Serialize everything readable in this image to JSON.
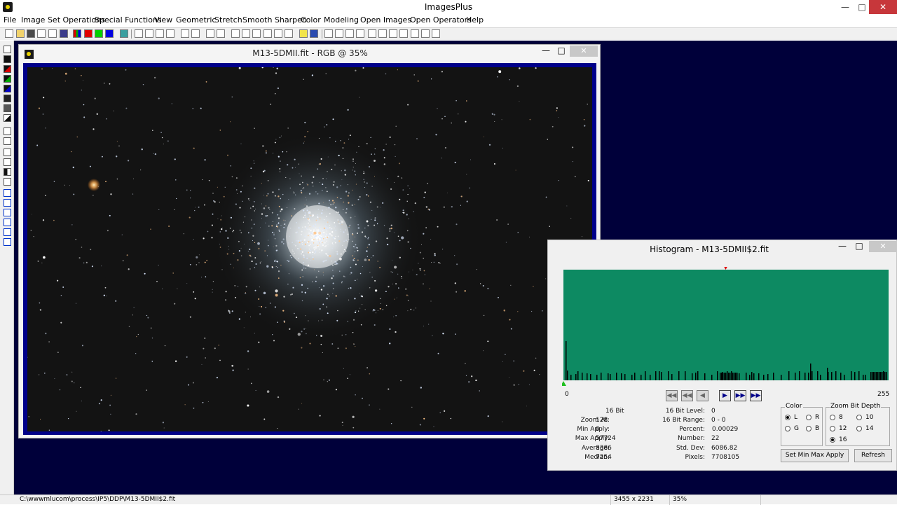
{
  "app": {
    "title": "ImagesPlus",
    "window_controls": {
      "minimize": "—",
      "maximize": "□",
      "close": "✕"
    }
  },
  "menu": [
    "File",
    "Image Set Operations",
    "Special Functions",
    "View",
    "Geometric",
    "Stretch",
    "Smooth Sharpen",
    "Color",
    "Modeling",
    "Open Images",
    "Open Operators",
    "Help"
  ],
  "image_window": {
    "title": "M13-5DMII.fit - RGB @ 35%",
    "controls": {
      "minimize": "—",
      "maximize": "□",
      "close": "✕"
    }
  },
  "histogram_window": {
    "title": "Histogram - M13-5DMII$2.fit",
    "controls": {
      "minimize": "—",
      "maximize": "□",
      "close": "✕"
    },
    "axis_min": "0",
    "axis_max": "255",
    "nav_buttons": [
      "first",
      "prev-fast",
      "prev",
      "next",
      "next-fast",
      "last"
    ],
    "stats_left": {
      "header": "16 Bit",
      "rows": [
        {
          "label": "Zoom At:",
          "value": "128"
        },
        {
          "label": "Min Apply:",
          "value": "0"
        },
        {
          "label": "Max Apply:",
          "value": "57724"
        },
        {
          "label": "Average:",
          "value": "8386"
        },
        {
          "label": "Median:",
          "value": "7254"
        }
      ]
    },
    "stats_right": {
      "rows": [
        {
          "label": "16 Bit Level:",
          "value": "0"
        },
        {
          "label": "16 Bit Range:",
          "value": "0 - 0"
        },
        {
          "label": "Percent:",
          "value": "0.00029"
        },
        {
          "label": "Number:",
          "value": "22"
        },
        {
          "label": "Std. Dev:",
          "value": "6086.82"
        },
        {
          "label": "Pixels:",
          "value": "7708105"
        }
      ]
    },
    "color_group": {
      "title": "Color",
      "options": [
        {
          "label": "L",
          "selected": true
        },
        {
          "label": "R",
          "selected": false
        },
        {
          "label": "G",
          "selected": false
        },
        {
          "label": "B",
          "selected": false
        }
      ]
    },
    "zoom_group": {
      "title": "Zoom Bit Depth",
      "options": [
        {
          "label": "8",
          "selected": false
        },
        {
          "label": "10",
          "selected": false
        },
        {
          "label": "12",
          "selected": false
        },
        {
          "label": "14",
          "selected": false
        },
        {
          "label": "16",
          "selected": true
        }
      ]
    },
    "buttons": {
      "set_minmax": "Set Min Max Apply",
      "refresh": "Refresh"
    },
    "colors": {
      "background": "#0d8a62",
      "bars": "#000000",
      "marker_top": "#e00000",
      "marker_bottom": "#20c020"
    }
  },
  "status": {
    "path": "C:\\wwwmlucom\\process\\IP5\\DDP\\M13-5DMII$2.fit",
    "dimensions": "3455 x 2231",
    "zoom": "35%"
  }
}
